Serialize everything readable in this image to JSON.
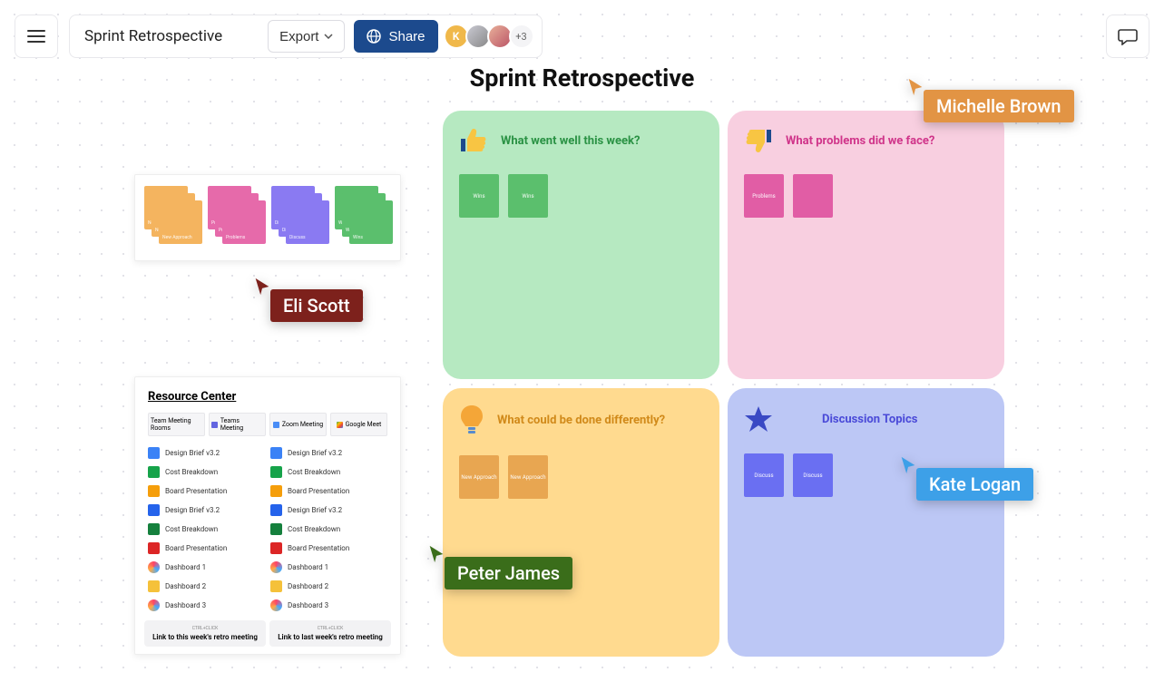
{
  "doc": {
    "title": "Sprint Retrospective",
    "export_label": "Export",
    "share_label": "Share",
    "avatar1_letter": "K",
    "avatar_more": "+3"
  },
  "canvas": {
    "title": "Sprint Retrospective"
  },
  "palette": {
    "stacks": [
      {
        "color": "#f4b45f",
        "labels": [
          "New",
          "New",
          "New Approach"
        ]
      },
      {
        "color": "#e66aaa",
        "labels": [
          "Prot",
          "Prot",
          "Problems"
        ]
      },
      {
        "color": "#8a7af2",
        "labels": [
          "Dis",
          "Dis",
          "Discuss"
        ]
      },
      {
        "color": "#5bbf6d",
        "labels": [
          "Wi",
          "Wi",
          "Wins"
        ]
      }
    ]
  },
  "quads": {
    "green": {
      "title": "What went well this week?",
      "notes": [
        "Wins",
        "Wins"
      ]
    },
    "pink": {
      "title": "What problems did we face?",
      "notes": [
        "Problems",
        ""
      ]
    },
    "yellow": {
      "title": "What could be done differently?",
      "notes": [
        "New Approach",
        "New Approach"
      ]
    },
    "blue": {
      "title": "Discussion Topics",
      "notes": [
        "Discuss",
        "Discuss"
      ]
    }
  },
  "resource": {
    "title": "Resource Center",
    "tabs": [
      "Team Meeting Rooms",
      "Teams Meeting",
      "Zoom Meeting",
      "Google Meet"
    ],
    "rows": [
      {
        "icon": "#3b82f6",
        "label": "Design Brief v3.2"
      },
      {
        "icon": "#16a34a",
        "label": "Cost Breakdown"
      },
      {
        "icon": "#f59e0b",
        "label": "Board Presentation"
      },
      {
        "icon": "#2563eb",
        "label": "Design Brief v3.2"
      },
      {
        "icon": "#15803d",
        "label": "Cost Breakdown"
      },
      {
        "icon": "#dc2626",
        "label": "Board Presentation"
      },
      {
        "icon_grad": true,
        "label": "Dashboard 1"
      },
      {
        "icon": "#f5c13a",
        "label": "Dashboard 2"
      },
      {
        "icon_grad": true,
        "label": "Dashboard 3"
      }
    ],
    "link_hint": "CTRL+CLICK",
    "link1": "Link to this week's retro meeting",
    "link2": "Link to last week's retro meeting"
  },
  "cursors": {
    "eli": "Eli Scott",
    "peter": "Peter James",
    "michelle": "Michelle Brown",
    "kate": "Kate Logan"
  },
  "colors": {
    "share": "#1c4a8d"
  }
}
